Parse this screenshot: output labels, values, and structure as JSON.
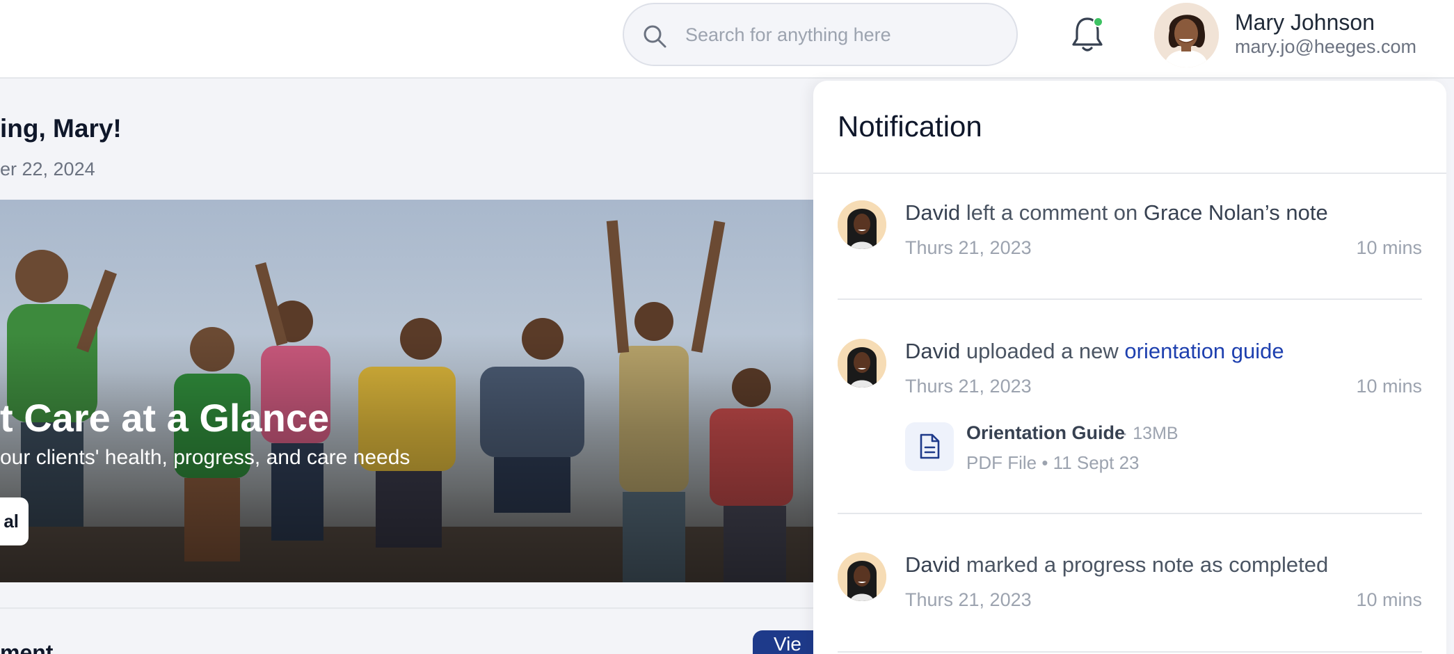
{
  "header": {
    "search": {
      "placeholder": "Search for anything here",
      "value": ""
    },
    "notification_indicator_color": "#3dc262",
    "user": {
      "name": "Mary Johnson",
      "email": "mary.jo@heeges.com"
    }
  },
  "main": {
    "greeting": "ing, Mary!",
    "date": "er 22, 2024",
    "hero": {
      "title": "t Care at a Glance",
      "subtitle": "our clients' health, progress, and care needs",
      "button_label": "al"
    },
    "section": {
      "title": "ment",
      "button_label": "Vie"
    }
  },
  "notification_panel": {
    "title": "Notification",
    "items": [
      {
        "actor": "David",
        "action": " left a comment on ",
        "target": "Grace Nolan’s note",
        "date": "Thurs 21, 2023",
        "time": "10 mins"
      },
      {
        "actor": "David",
        "action": " uploaded a new ",
        "link": "orientation guide",
        "date": "Thurs 21, 2023",
        "time": "10 mins",
        "attachment": {
          "name": "Orientation Guide",
          "size": "· 13MB",
          "meta": "PDF File • 11 Sept 23"
        }
      },
      {
        "actor": "David",
        "action": " marked a progress note as completed",
        "date": "Thurs 21, 2023",
        "time": "10 mins"
      }
    ]
  },
  "colors": {
    "accent": "#1e3a8a",
    "link": "#1e40af",
    "background": "#f3f4f8"
  }
}
